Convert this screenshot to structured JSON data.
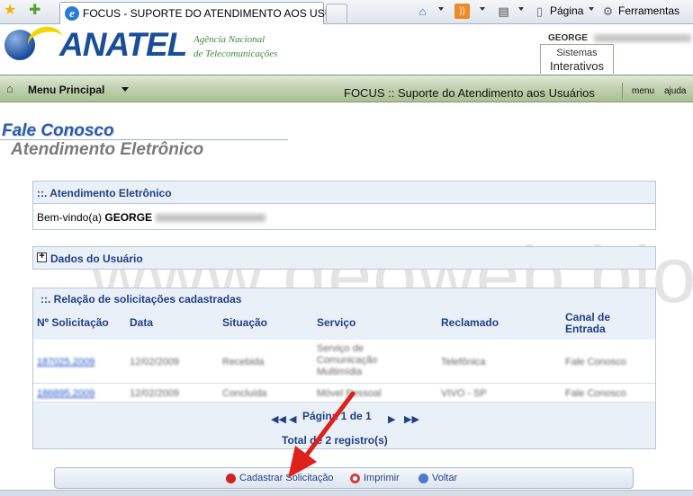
{
  "browser": {
    "tab_title": "FOCUS - SUPORTE DO ATENDIMENTO AOS USU...",
    "toolbar": {
      "page_label": "Página",
      "tools_label": "Ferramentas"
    }
  },
  "header": {
    "logo_text": "ANATEL",
    "agency_line1": "Agência Nacional",
    "agency_line2": "de Telecomunicações",
    "user_first_name": "GEORGE",
    "systems_line1": "Sistemas",
    "systems_line2": "Interativos"
  },
  "menu_bar": {
    "main_menu_label": "Menu Principal",
    "title": "FOCUS :: Suporte do Atendimento aos Usuários",
    "links": [
      "menu",
      "ajuda"
    ]
  },
  "page": {
    "title": "Fale Conosco",
    "subtitle": "Atendimento Eletrônico"
  },
  "panel_atendimento": {
    "header": "::. Atendimento Eletrônico",
    "welcome_prefix": "Bem-vindo(a)",
    "welcome_name": "GEORGE"
  },
  "panel_dados": {
    "header": "Dados do Usuário"
  },
  "panel_solicitacoes": {
    "header": "::.   Relação de solicitações cadastradas",
    "columns": [
      "Nº Solicitação",
      "Data",
      "Situação",
      "Serviço",
      "Reclamado",
      "Canal de Entrada"
    ],
    "rows": [
      {
        "numero": "187025.2009",
        "data": "12/02/2009",
        "situacao": "Recebida",
        "servico_l1": "Serviço de",
        "servico_l2": "Comunicação",
        "servico_l3": "Multimídia",
        "reclamado": "Telefônica",
        "canal": "Fale Conosco"
      },
      {
        "numero": "186895.2009",
        "data": "12/02/2009",
        "situacao": "Concluída",
        "servico_l1": "Móvel Pessoal",
        "reclamado": "VIVO - SP",
        "canal": "Fale Conosco"
      }
    ],
    "pager": {
      "text": "Página 1 de 1",
      "first": "◀◀",
      "prev": "◀",
      "next": "▶",
      "last": "▶▶"
    },
    "total": "Total de 2 registro(s)"
  },
  "watermark": "www.geoweb.blog.br",
  "actions": {
    "register": "Cadastrar Solicitação",
    "print": "Imprimir",
    "back": "Voltar"
  },
  "colors": {
    "brand_blue": "#1a4e98",
    "panel_text": "#1f3f86",
    "menu_green": "#c3d3b2",
    "annotation_arrow": "#e0201a"
  }
}
